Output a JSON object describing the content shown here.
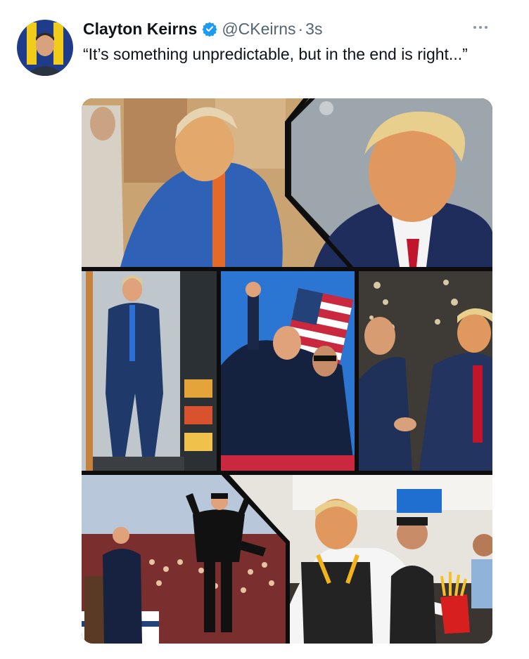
{
  "tweet": {
    "author": {
      "display_name": "Clayton Keirns",
      "handle": "@CKeirns",
      "verified": true,
      "avatar_icon": "user-avatar-photo"
    },
    "separator": "·",
    "timestamp": "3s",
    "text": "“It’s something unpredictable, but in the end is right...”",
    "more_icon": "more-horizontal-icon",
    "media": {
      "type": "collage",
      "panels": [
        "courtroom-sketch",
        "portrait-mugshot",
        "walking-in-store",
        "fist-raised-with-flag",
        "handshake-with-sparks",
        "rally-stage-jump",
        "restaurant-fries"
      ]
    }
  },
  "colors": {
    "text_primary": "#0f1419",
    "text_secondary": "#536471",
    "verified_blue": "#1d9bf0"
  }
}
